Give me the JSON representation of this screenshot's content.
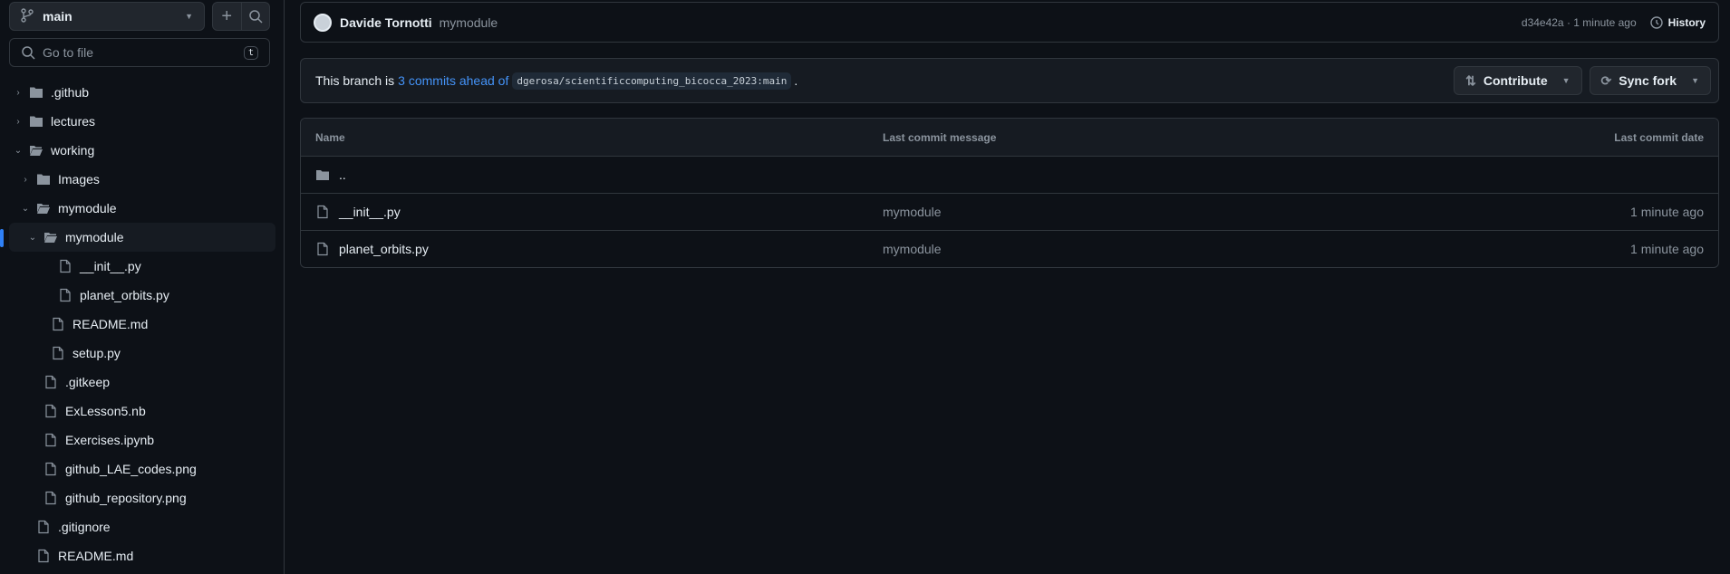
{
  "sidebar": {
    "branch": "main",
    "goto_placeholder": "Go to file",
    "goto_kbd": "t",
    "tree": [
      {
        "label": ".github",
        "type": "folder",
        "depth": 0,
        "expanded": false
      },
      {
        "label": "lectures",
        "type": "folder",
        "depth": 0,
        "expanded": false
      },
      {
        "label": "working",
        "type": "folder",
        "depth": 0,
        "expanded": true
      },
      {
        "label": "Images",
        "type": "folder",
        "depth": 1,
        "expanded": false
      },
      {
        "label": "mymodule",
        "type": "folder",
        "depth": 1,
        "expanded": true
      },
      {
        "label": "mymodule",
        "type": "folder",
        "depth": 2,
        "expanded": true,
        "selected": true
      },
      {
        "label": "__init__.py",
        "type": "file",
        "depth": 3
      },
      {
        "label": "planet_orbits.py",
        "type": "file",
        "depth": 3
      },
      {
        "label": "README.md",
        "type": "file",
        "depth": 2
      },
      {
        "label": "setup.py",
        "type": "file",
        "depth": 2
      },
      {
        "label": ".gitkeep",
        "type": "file",
        "depth": 1
      },
      {
        "label": "ExLesson5.nb",
        "type": "file",
        "depth": 1
      },
      {
        "label": "Exercises.ipynb",
        "type": "file",
        "depth": 1
      },
      {
        "label": "github_LAE_codes.png",
        "type": "file",
        "depth": 1
      },
      {
        "label": "github_repository.png",
        "type": "file",
        "depth": 1
      },
      {
        "label": ".gitignore",
        "type": "file",
        "depth": 0
      },
      {
        "label": "README.md",
        "type": "file",
        "depth": 0
      }
    ]
  },
  "commit": {
    "author": "Davide Tornotti",
    "message": "mymodule",
    "sha_time": "d34e42a · 1 minute ago",
    "history": "History"
  },
  "branch_status": {
    "prefix": "This branch is",
    "link": "3 commits ahead of",
    "upstream": "dgerosa/scientificcomputing_bicocca_2023:main",
    "suffix": ".",
    "contribute": "Contribute",
    "sync": "Sync fork"
  },
  "table": {
    "headers": [
      "Name",
      "Last commit message",
      "Last commit date"
    ],
    "parent": "..",
    "rows": [
      {
        "name": "__init__.py",
        "message": "mymodule",
        "date": "1 minute ago"
      },
      {
        "name": "planet_orbits.py",
        "message": "mymodule",
        "date": "1 minute ago"
      }
    ]
  },
  "colors": {
    "accent": "#4493f8",
    "bg": "#0d1117",
    "border": "#30363d"
  }
}
